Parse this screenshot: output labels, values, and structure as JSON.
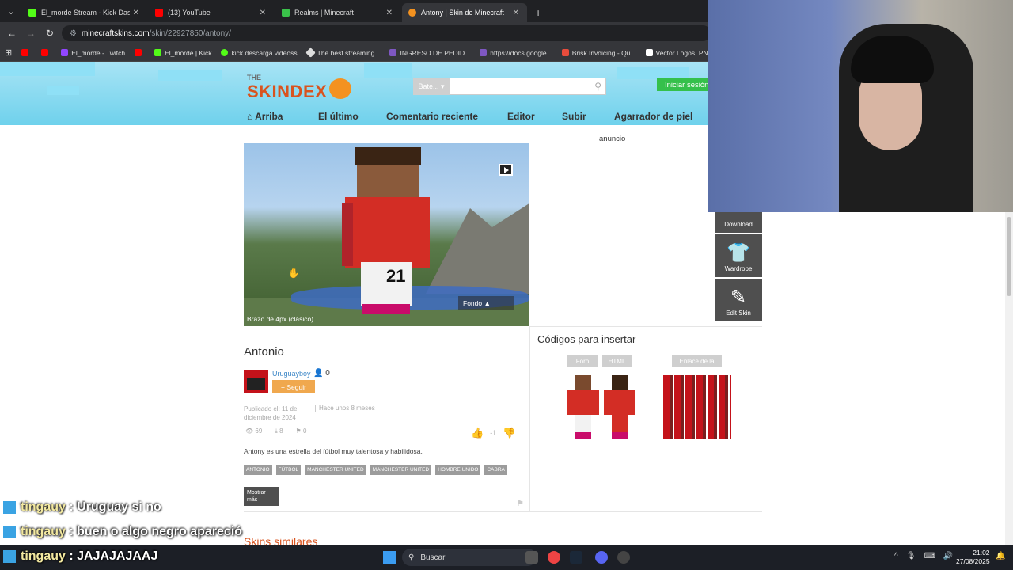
{
  "browser": {
    "tabs": [
      {
        "title": "El_morde Stream - Kick Dashbo",
        "color": "#53fc18"
      },
      {
        "title": "(13) YouTube",
        "color": "#ff0000"
      },
      {
        "title": "Realms | Minecraft",
        "color": "#3ac24a"
      },
      {
        "title": "Antony | Skin de Minecraft",
        "color": "#f39220"
      }
    ],
    "url_host": "minecraftskins.com",
    "url_path": "/skin/22927850/antony/",
    "bookmarks": [
      "El_morde - Twitch",
      "El_morde | Kick",
      "kick descarga videoss",
      "The best streaming...",
      "INGRESO DE PEDID...",
      "https://docs.google...",
      "Brisk Invoicing - Qu...",
      "Vector Logos, PNG I..."
    ]
  },
  "site": {
    "logo_the": "THE",
    "logo_name": "SKINDEX",
    "search_select": "Bate...",
    "login": "Iniciar sesión",
    "nav": [
      "Arriba",
      "El último",
      "Comentario reciente",
      "Editor",
      "Subir",
      "Agarrador de piel"
    ]
  },
  "viewer": {
    "caption": "Brazo de 4px (clásico)",
    "fondo": "Fondo ▲",
    "number": "21"
  },
  "ad_label": "anuncio",
  "tools": {
    "download": "Download",
    "wardrobe": "Wardrobe",
    "edit": "Edit Skin"
  },
  "skin": {
    "title": "Antonio",
    "author": "Uruguayboy",
    "followers": "0",
    "follow": "+ Seguir",
    "published": "Publicado el: 11 de diciembre de 2024",
    "ago": "Hace unos 8 meses",
    "views": "69",
    "downloads": "8",
    "favorites": "0",
    "rating": "-1",
    "description": "Antony es una estrella del fútbol muy talentosa y habilidosa.",
    "tags": [
      "ANTONIO",
      "FÚTBOL",
      "MANCHESTER UNITED",
      "MANCHESTER UNITED",
      "HOMBRE UNIDO",
      "CABRA"
    ],
    "more": "Mostrar más"
  },
  "embed": {
    "title": "Códigos para insertar",
    "foro": "Foro",
    "html": "HTML",
    "enlace": "Enlace de la"
  },
  "similar_title": "Skins similares",
  "chat": [
    {
      "user": "tingauy",
      "message": ": Uruguay si no"
    },
    {
      "user": "tingauy",
      "message": ": buen o algo negro apareció"
    },
    {
      "user": "tingauy",
      "message": ": JAJAJAJAAJ"
    }
  ],
  "taskbar": {
    "search": "Buscar",
    "time": "21:02",
    "date": "27/08/2025"
  }
}
